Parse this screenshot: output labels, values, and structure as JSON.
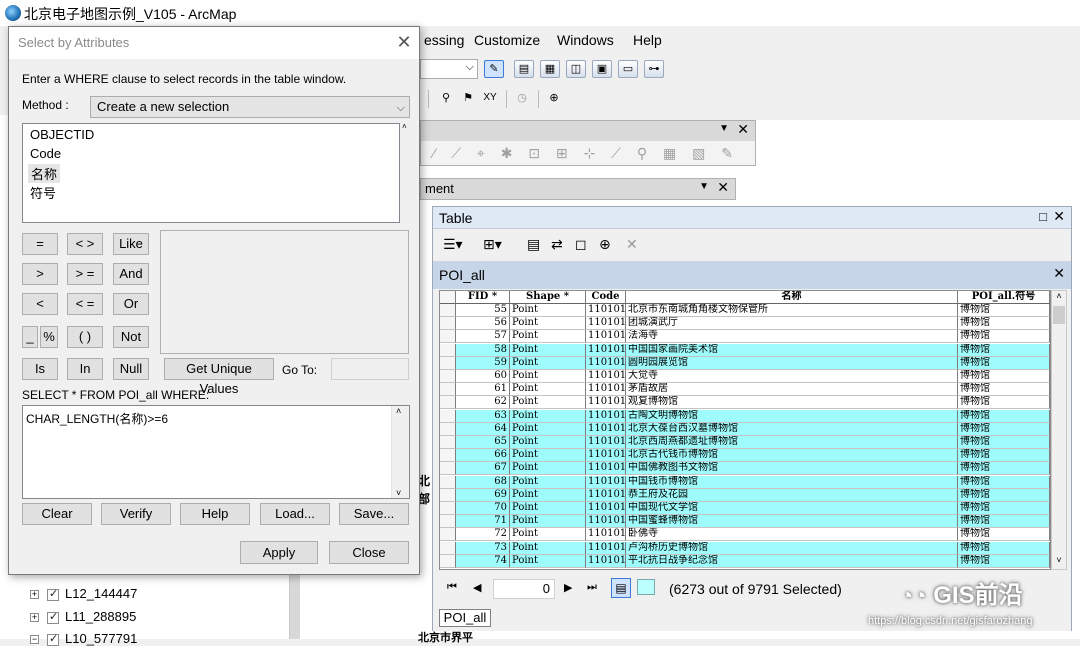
{
  "app": {
    "title": "北京电子地图示例_V105 - ArcMap",
    "menus": [
      "essing",
      "Customize",
      "Windows",
      "Help"
    ]
  },
  "map": {
    "text_fragments": [
      "北",
      "部",
      "北京市界平"
    ]
  },
  "toc": {
    "layers": [
      "L12_144447",
      "L11_288895",
      "L10_577791"
    ]
  },
  "floating_bars": {
    "bar2_title": "ment"
  },
  "dialog": {
    "title": "Select by Attributes",
    "instruction": "Enter a WHERE clause to select records in the table window.",
    "method_label": "Method :",
    "method_value": "Create a new selection",
    "fields": [
      "OBJECTID",
      "Code",
      "名称",
      "符号"
    ],
    "selected_field_index": 2,
    "operators": [
      "=",
      "< >",
      "Like",
      ">",
      "> =",
      "And",
      "<",
      "< =",
      "Or",
      "_",
      "%",
      "( )",
      "Not",
      "Is",
      "In",
      "Null"
    ],
    "get_unique_values": "Get Unique Values",
    "goto_label": "Go To:",
    "sql_prefix": "SELECT * FROM POI_all WHERE:",
    "sql_expression": "CHAR_LENGTH(名称)>=6",
    "buttons": {
      "clear": "Clear",
      "verify": "Verify",
      "help": "Help",
      "load": "Load...",
      "save": "Save...",
      "apply": "Apply",
      "close": "Close"
    }
  },
  "table": {
    "window_title": "Table",
    "layer_tab": "POI_all",
    "columns": [
      "FID *",
      "Shape *",
      "Code",
      "名称",
      "POI_all.符号"
    ],
    "rows": [
      {
        "fid": "55",
        "shape": "Point",
        "code": "110101",
        "name": "北京市东南城角角楼文物保管所",
        "symbol": "博物馆",
        "selected": false
      },
      {
        "fid": "56",
        "shape": "Point",
        "code": "110101",
        "name": "团城演武厅",
        "symbol": "博物馆",
        "selected": false
      },
      {
        "fid": "57",
        "shape": "Point",
        "code": "110101",
        "name": "法海寺",
        "symbol": "博物馆",
        "selected": false
      },
      {
        "fid": "58",
        "shape": "Point",
        "code": "110101",
        "name": "中国国家画院美术馆",
        "symbol": "博物馆",
        "selected": true
      },
      {
        "fid": "59",
        "shape": "Point",
        "code": "110101",
        "name": "圆明园展览馆",
        "symbol": "博物馆",
        "selected": true
      },
      {
        "fid": "60",
        "shape": "Point",
        "code": "110101",
        "name": "大觉寺",
        "symbol": "博物馆",
        "selected": false
      },
      {
        "fid": "61",
        "shape": "Point",
        "code": "110101",
        "name": "茅盾故居",
        "symbol": "博物馆",
        "selected": false
      },
      {
        "fid": "62",
        "shape": "Point",
        "code": "110101",
        "name": "观复博物馆",
        "symbol": "博物馆",
        "selected": false
      },
      {
        "fid": "63",
        "shape": "Point",
        "code": "110101",
        "name": "古陶文明博物馆",
        "symbol": "博物馆",
        "selected": true
      },
      {
        "fid": "64",
        "shape": "Point",
        "code": "110101",
        "name": "北京大葆台西汉墓博物馆",
        "symbol": "博物馆",
        "selected": true
      },
      {
        "fid": "65",
        "shape": "Point",
        "code": "110101",
        "name": "北京西周燕都遗址博物馆",
        "symbol": "博物馆",
        "selected": true
      },
      {
        "fid": "66",
        "shape": "Point",
        "code": "110101",
        "name": "北京古代钱币博物馆",
        "symbol": "博物馆",
        "selected": true
      },
      {
        "fid": "67",
        "shape": "Point",
        "code": "110101",
        "name": "中国佛教图书文物馆",
        "symbol": "博物馆",
        "selected": true
      },
      {
        "fid": "68",
        "shape": "Point",
        "code": "110101",
        "name": "中国钱币博物馆",
        "symbol": "博物馆",
        "selected": true
      },
      {
        "fid": "69",
        "shape": "Point",
        "code": "110101",
        "name": "恭王府及花园",
        "symbol": "博物馆",
        "selected": true
      },
      {
        "fid": "70",
        "shape": "Point",
        "code": "110101",
        "name": "中国现代文学馆",
        "symbol": "博物馆",
        "selected": true
      },
      {
        "fid": "71",
        "shape": "Point",
        "code": "110101",
        "name": "中国蜜蜂博物馆",
        "symbol": "博物馆",
        "selected": true
      },
      {
        "fid": "72",
        "shape": "Point",
        "code": "110101",
        "name": "卧佛寺",
        "symbol": "博物馆",
        "selected": false
      },
      {
        "fid": "73",
        "shape": "Point",
        "code": "110101",
        "name": "卢沟桥历史博物馆",
        "symbol": "博物馆",
        "selected": true
      },
      {
        "fid": "74",
        "shape": "Point",
        "code": "110101",
        "name": "平北抗日战争纪念馆",
        "symbol": "博物馆",
        "selected": true
      }
    ],
    "nav_record": "0",
    "selection_status": "(6273 out of 9791 Selected)",
    "bottom_tab": "POI_all"
  },
  "watermark": {
    "brand": "GIS前沿",
    "url": "https://blog.csdn.net/gisfarozhang"
  },
  "colors": {
    "selected_row": "#9ffcfc",
    "table_title_bg": "#dfe8f5",
    "table_tab_bg": "#c7d5e9"
  }
}
